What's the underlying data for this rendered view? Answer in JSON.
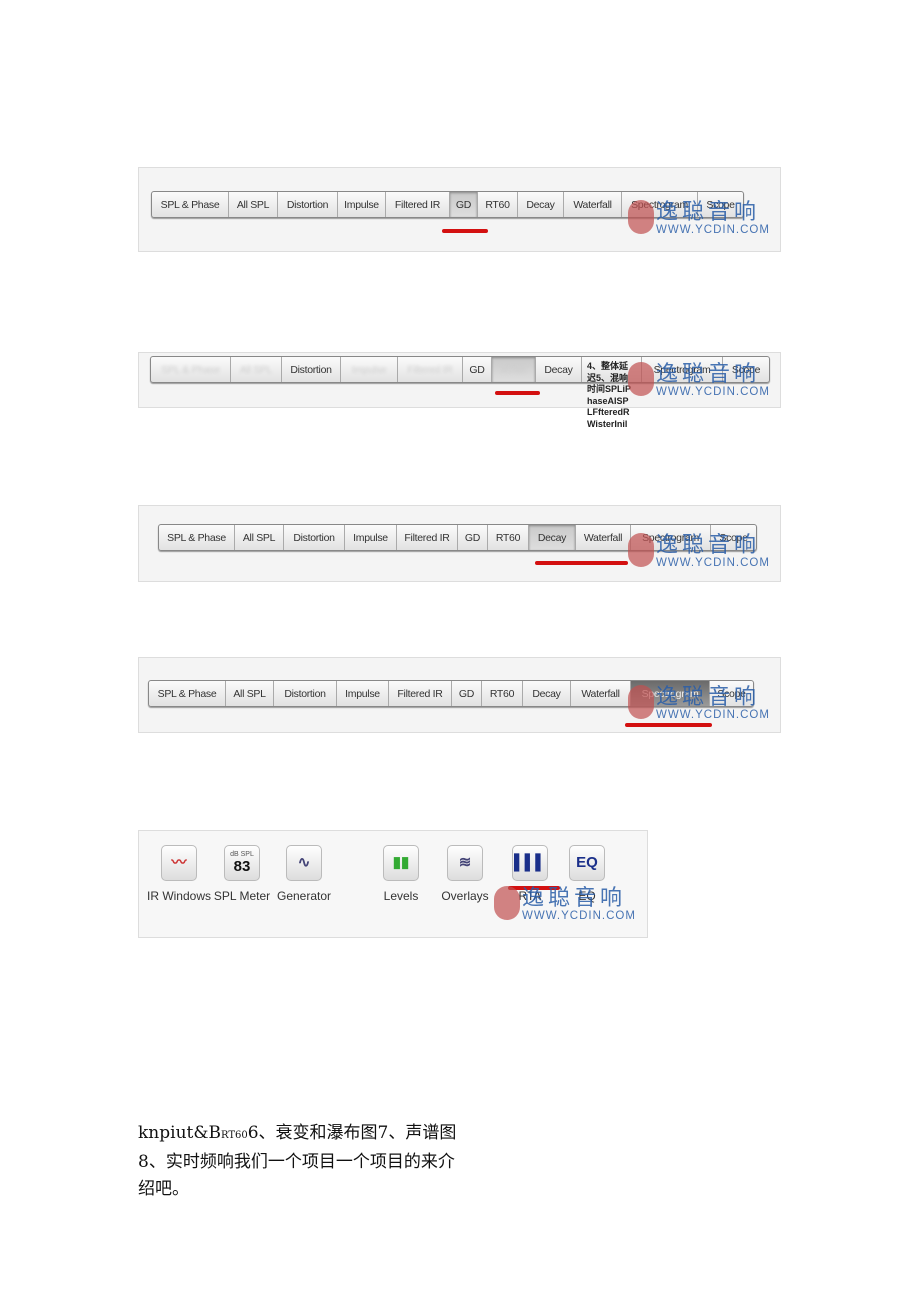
{
  "watermark": {
    "cn": "逸聪音响",
    "url": "WWW.YCDIN.COM"
  },
  "accent_red": "#d31010",
  "toolbars": [
    {
      "buttons": [
        {
          "label": "SPL & Phase"
        },
        {
          "label": "All SPL"
        },
        {
          "label": "Distortion"
        },
        {
          "label": "Impulse"
        },
        {
          "label": "Filtered IR"
        },
        {
          "label": "GD",
          "state": "active"
        },
        {
          "label": "RT60"
        },
        {
          "label": "Decay"
        },
        {
          "label": "Waterfall"
        },
        {
          "label": "Spectrogram"
        },
        {
          "label": "Scope"
        }
      ]
    },
    {
      "buttons": [
        {
          "label": "SPL & Phase",
          "state": "blur"
        },
        {
          "label": "All SPL",
          "state": "blur"
        },
        {
          "label": "Distortion"
        },
        {
          "label": "Impulse",
          "state": "blur"
        },
        {
          "label": "Filtered IR",
          "state": "blur"
        },
        {
          "label": "GD"
        },
        {
          "label": "RT60",
          "state": "active-blur"
        },
        {
          "label": "Decay"
        },
        {
          "label": ""
        },
        {
          "label": "Spectrogram"
        },
        {
          "label": "Scope"
        }
      ],
      "overlay_text": [
        "4、整体延",
        "迟5、混响",
        "时间SPLiP",
        "haseAISP",
        "LFfteredR",
        "WisterInil"
      ]
    },
    {
      "buttons": [
        {
          "label": "SPL & Phase"
        },
        {
          "label": "All SPL"
        },
        {
          "label": "Distortion"
        },
        {
          "label": "Impulse"
        },
        {
          "label": "Filtered IR"
        },
        {
          "label": "GD"
        },
        {
          "label": "RT60"
        },
        {
          "label": "Decay",
          "state": "active"
        },
        {
          "label": "Waterfall"
        },
        {
          "label": "Spectrogram"
        },
        {
          "label": "Scope"
        }
      ]
    },
    {
      "buttons": [
        {
          "label": "SPL & Phase"
        },
        {
          "label": "All SPL"
        },
        {
          "label": "Distortion"
        },
        {
          "label": "Impulse"
        },
        {
          "label": "Filtered IR"
        },
        {
          "label": "GD"
        },
        {
          "label": "RT60"
        },
        {
          "label": "Decay"
        },
        {
          "label": "Waterfall"
        },
        {
          "label": "Spectrogram",
          "state": "dark"
        },
        {
          "label": "Scope"
        }
      ]
    }
  ],
  "tools": [
    {
      "label": "IR Windows",
      "icon": "ir-windows-icon",
      "glyph": "〰"
    },
    {
      "label": "SPL Meter",
      "icon": "spl-meter-icon",
      "glyph": "83",
      "sub": "dB SPL"
    },
    {
      "label": "Generator",
      "icon": "generator-icon",
      "glyph": "∿"
    },
    {
      "label": "Levels",
      "icon": "levels-icon",
      "glyph": "▮▮"
    },
    {
      "label": "Overlays",
      "icon": "overlays-icon",
      "glyph": "≋"
    },
    {
      "label": "RTA",
      "icon": "rta-icon",
      "glyph": "▌▌▌"
    },
    {
      "label": "EQ",
      "icon": "eq-icon",
      "glyph": "EQ"
    }
  ],
  "paragraph": {
    "prefix": "knpiut&B",
    "small": "RT60",
    "text": "6、衰变和瀑布图7、声谱图8、实时频响我们一个项目一个项目的来介绍吧。"
  }
}
